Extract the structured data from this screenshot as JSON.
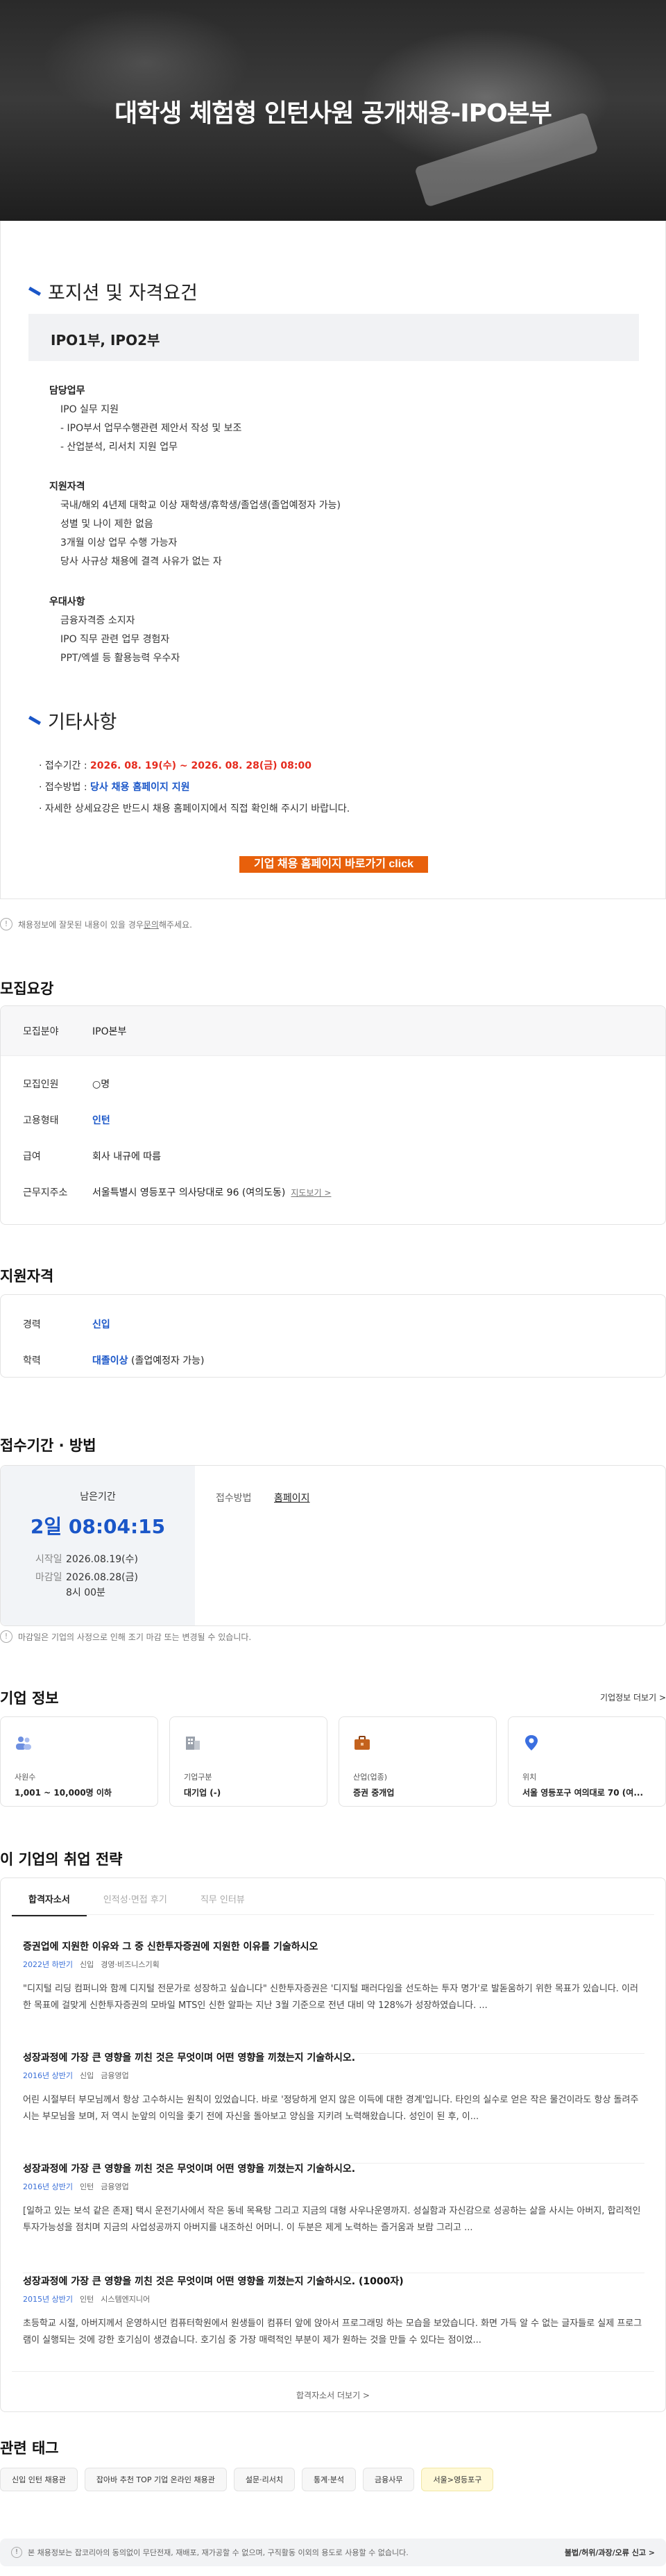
{
  "hero": {
    "title": "대학생 체험형 인턴사원 공개채용-IPO본부"
  },
  "poster": {
    "position_title": "포지션 및 자격요건",
    "position_box": "IPO1부, IPO2부",
    "duty": {
      "heading": "담당업무",
      "items": [
        "IPO 실무 지원",
        "- IPO부서 업무수행관련 제안서 작성 및 보조",
        "- 산업분석, 리서치 지원 업무"
      ]
    },
    "qual": {
      "heading": "지원자격",
      "items": [
        "국내/해외 4년제 대학교 이상 재학생/휴학생/졸업생(졸업예정자 가능)",
        "성별 및 나이 제한 없음",
        "3개월 이상 업무 수행 가능자",
        "당사 사규상 채용에 결격 사유가 없는 자"
      ]
    },
    "pref": {
      "heading": "우대사항",
      "items": [
        "금융자격증 소지자",
        "IPO 직무 관련 업무 경험자",
        "PPT/엑셀 등 활용능력 우수자"
      ]
    },
    "etc_title": "기타사항",
    "etc_period_label": "접수기간 : ",
    "etc_period_value": "2026. 08. 19(수) ~ 2026. 08. 28(금) 08:00",
    "etc_method_label": "접수방법 : ",
    "etc_method_value": "당사 채용 홈페이지 지원",
    "etc_note": "자세한 상세요강은 반드시 채용 홈페이지에서 직접 확인해 주시기 바랍니다.",
    "apply_button": "기업 채용 홈페이지 바로가기 click"
  },
  "note1": {
    "text": "채용정보에 잘못된 내용이 있을 경우 ",
    "link": "문의",
    "suffix": "해주세요."
  },
  "recruit": {
    "title": "모집요강",
    "field_label": "모집분야",
    "field_value": "IPO본부",
    "count_label": "모집인원",
    "count_value": "○명",
    "type_label": "고용형태",
    "type_value": "인턴",
    "salary_label": "급여",
    "salary_value": "회사 내규에 따름",
    "location_label": "근무지주소",
    "location_value": "서울특별시 영등포구 의사당대로 96 (여의도동)",
    "map_link": "지도보기 >"
  },
  "qualification": {
    "title": "지원자격",
    "career_label": "경력",
    "career_value": "신입",
    "edu_label": "학력",
    "edu_value": "대졸이상",
    "edu_suffix": " (졸업예정자 가능)"
  },
  "deadline": {
    "title": "접수기간 · 방법",
    "remain_label": "남은기간",
    "remain_value": "2일 08:04:15",
    "start_label": "시작일",
    "start_value": "2026.08.19(수)",
    "end_label": "마감일",
    "end_value": "2026.08.28(금)",
    "end_time": "8시 00분",
    "method_label": "접수방법",
    "method_value": "홈페이지"
  },
  "note2": {
    "text": "마감일은 기업의 사정으로 인해 조기 마감 또는 변경될 수 있습니다."
  },
  "company": {
    "title": "기업 정보",
    "more": "기업정보 더보기 >",
    "boxes": [
      {
        "label": "사원수",
        "value": "1,001 ~ 10,000명 이하",
        "icon": "people-icon"
      },
      {
        "label": "기업구분",
        "value": "대기업 (-)",
        "icon": "building-icon"
      },
      {
        "label": "산업(업종)",
        "value": "증권 중개업",
        "icon": "briefcase-icon"
      },
      {
        "label": "위치",
        "value": "서울 영등포구 여의대로 70 (여...",
        "icon": "location-pin-icon"
      }
    ],
    "colors": {
      "people": "#6d8fe0",
      "building": "#9aa1ab",
      "briefcase": "#c4621d",
      "pin": "#3b6fe0"
    }
  },
  "strategy": {
    "title": "이 기업의 취업 전략",
    "tabs": [
      "합격자소서",
      "인적성·면접 후기",
      "직무 인터뷰"
    ],
    "items": [
      {
        "q": "증권업에 지원한 이유와 그 중 신한투자증권에 지원한 이유를 기술하시오",
        "year": "2022년 하반기",
        "kind": "신입",
        "dept": "경영·비즈니스기획",
        "a": "\"디지털 리딩 컴퍼니와 함께 디지털 전문가로 성장하고 싶습니다\" 신한투자증권은 '디지털 패러다임을 선도하는 투자 명가'로 발돋움하기 위한 목표가 있습니다. 이러한 목표에 걸맞게 신한투자증권의 모바일 MTS인 신한 알파는 지난 3월 기준으로 전년 대비 약 128%가 성장하였습니다. ..."
      },
      {
        "q": "성장과정에 가장 큰 영향을 끼친 것은 무엇이며 어떤 영향을 끼쳤는지 기술하시오.",
        "year": "2016년 상반기",
        "kind": "신입",
        "dept": "금융영업",
        "a": "어린 시절부터 부모님께서 항상 고수하시는 원칙이 있었습니다. 바로 '정당하게 얻지 않은 이득에 대한 경계'입니다. 타인의 실수로 얻은 작은 물건이라도 항상 돌려주시는 부모님을 보며, 저 역시 눈앞의 이익을 좇기 전에 자신을 돌아보고 양심을 지키려 노력해왔습니다. 성인이 된 후, 이..."
      },
      {
        "q": "성장과정에 가장 큰 영향을 끼친 것은 무엇이며 어떤 영향을 끼쳤는지 기술하시오.",
        "year": "2016년 상반기",
        "kind": "인턴",
        "dept": "금융영업",
        "a": "[일하고 있는 보석 같은 존재] 택시 운전기사에서 작은 동네 목욕탕 그리고 지금의 대형 사우나운영까지. 성실함과 자신감으로 성공하는 삶을 사시는 아버지, 합리적인 투자가능성을 점치며 지금의 사업성공까지 아버지를 내조하신 어머니. 이 두분은 제게 노력하는 즐거움과 보람 그리고 ..."
      },
      {
        "q": "성장과정에 가장 큰 영향을 끼친 것은 무엇이며 어떤 영향을 끼쳤는지 기술하시오. (1000자)",
        "year": "2015년 상반기",
        "kind": "인턴",
        "dept": "시스템엔지니어",
        "a": "초등학교 시절, 아버지께서 운영하시던 컴퓨터학원에서 원생들이 컴퓨터 앞에 앉아서 프로그래밍 하는 모습을 보았습니다. 화면 가득 알 수 없는 글자들로 실제 프로그램이 실행되는 것에 강한 호기심이 생겼습니다. 호기심 중 가장 매력적인 부분이 제가 원하는 것을 만들 수 있다는 점이었..."
      }
    ],
    "more": "합격자소서 더보기 >"
  },
  "tags": {
    "title": "관련 태그",
    "items": [
      "신입 인턴 채용관",
      "잡아바 추천 TOP 기업 온라인 채용관",
      "설문·리서치",
      "통계·분석",
      "금융사무",
      "서울>영등포구"
    ]
  },
  "footer": {
    "text": "본 채용정보는 잡코리아의 동의없이 무단전재, 재배포, 재가공할 수 없으며, 구직활동 이외의 용도로 사용할 수 없습니다.",
    "report": "불법/허위/과장/오류 신고 >"
  }
}
